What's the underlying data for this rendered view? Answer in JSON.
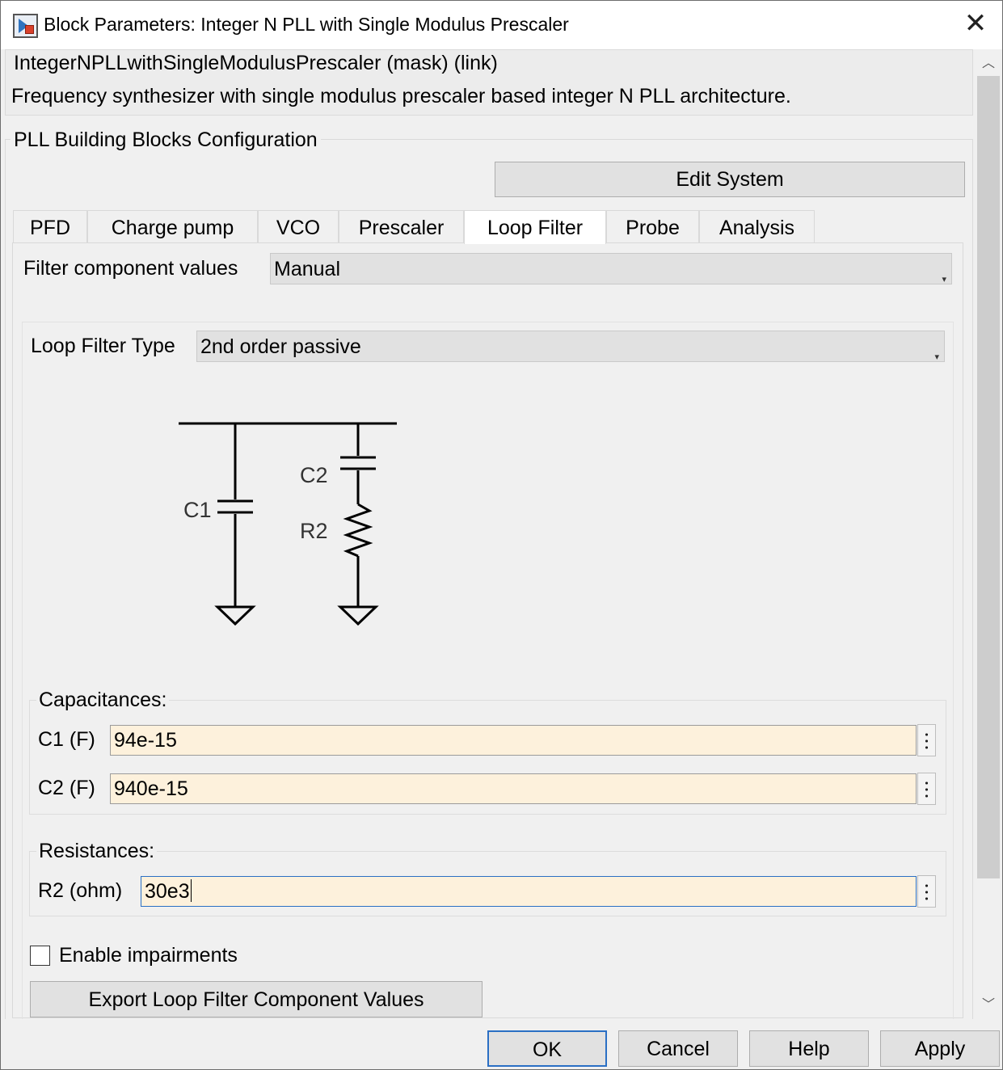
{
  "window": {
    "title": "Block Parameters: Integer N PLL with Single Modulus Prescaler",
    "close_glyph": "✕"
  },
  "mask": {
    "title": "IntegerNPLLwithSingleModulusPrescaler (mask) (link)",
    "description": "Frequency synthesizer with single modulus prescaler based integer N PLL architecture."
  },
  "config": {
    "title": "PLL Building Blocks Configuration",
    "edit_system_label": "Edit System"
  },
  "tabs": [
    {
      "label": "PFD"
    },
    {
      "label": "Charge pump"
    },
    {
      "label": "VCO"
    },
    {
      "label": "Prescaler"
    },
    {
      "label": "Loop Filter",
      "active": true
    },
    {
      "label": "Probe"
    },
    {
      "label": "Analysis"
    }
  ],
  "loop_filter": {
    "component_values_label": "Filter component values",
    "component_values_selected": "Manual",
    "type_label": "Loop Filter Type",
    "type_selected": "2nd order passive",
    "schematic": {
      "c1_label": "C1",
      "c2_label": "C2",
      "r2_label": "R2"
    },
    "capacitances": {
      "legend": "Capacitances:",
      "c1_label": "C1 (F)",
      "c1_value": "94e-15",
      "c2_label": "C2 (F)",
      "c2_value": "940e-15"
    },
    "resistances": {
      "legend": "Resistances:",
      "r2_label": "R2 (ohm)",
      "r2_value": "30e3"
    },
    "enable_impairments_label": "Enable impairments",
    "enable_impairments_checked": false,
    "export_label": "Export Loop Filter Component Values"
  },
  "buttons": {
    "ok": "OK",
    "cancel": "Cancel",
    "help": "Help",
    "apply": "Apply"
  },
  "colors": {
    "edit_field_bg": "#fdf1dc",
    "focus_border": "#2a6fc4"
  }
}
